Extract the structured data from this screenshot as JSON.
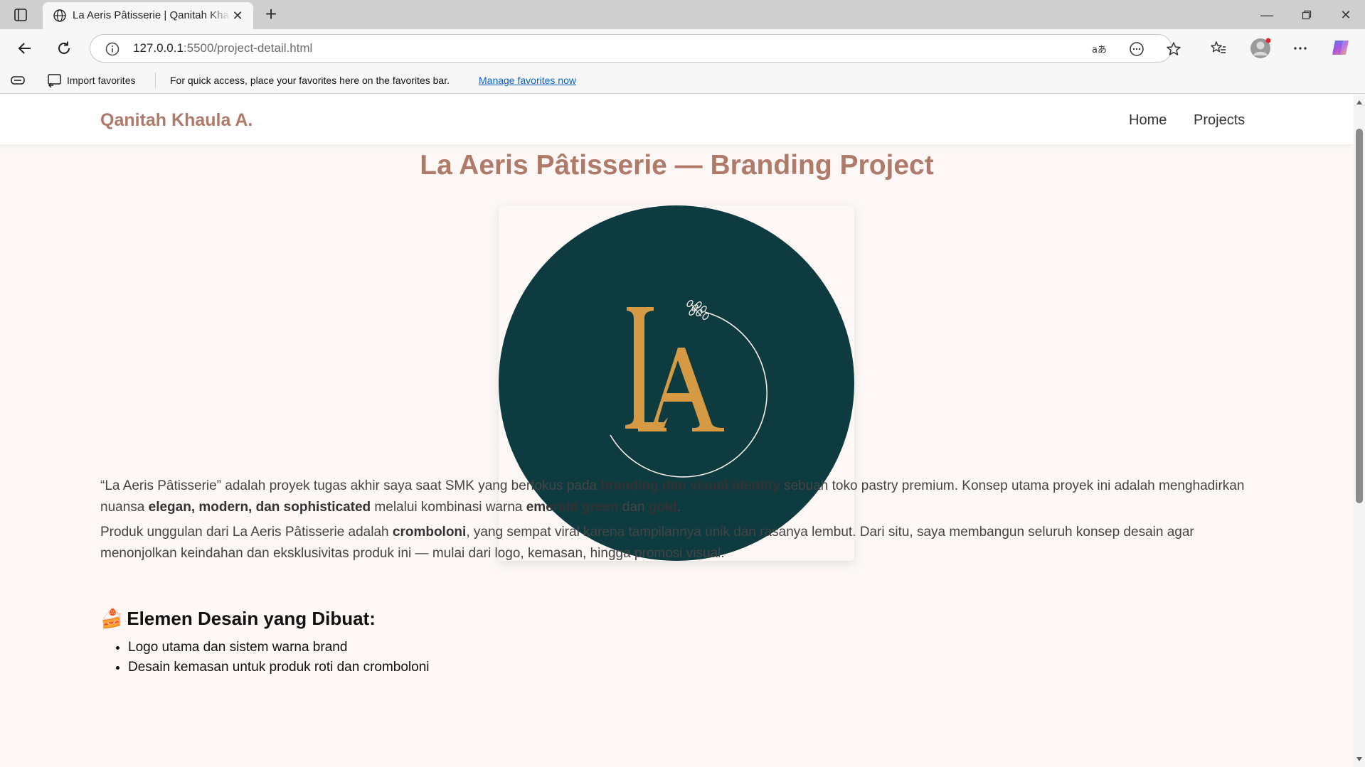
{
  "browser": {
    "tab_title": "La Aeris Pâtisserie | Qanitah Khaula A.",
    "url_host": "127.0.0.1",
    "url_path": ":5500/project-detail.html",
    "favorites": {
      "import_label": "Import favorites",
      "hint": "For quick access, place your favorites here on the favorites bar.",
      "manage_link": "Manage favorites now"
    },
    "icons": [
      "tab-actions-icon",
      "globe-icon",
      "close-icon",
      "new-tab-icon",
      "minimize-icon",
      "maximize-icon",
      "window-close-icon",
      "back-icon",
      "refresh-icon",
      "info-icon",
      "translate-icon",
      "reader-icon",
      "star-icon",
      "favorites-icon",
      "profile-icon",
      "more-icon",
      "copilot-icon",
      "favorites-bar-icon",
      "import-icon"
    ]
  },
  "site": {
    "brand": "Qanitah Khaula A.",
    "nav": [
      "Home",
      "Projects"
    ],
    "accent_color": "#b07a6a",
    "logo": {
      "letters": "LA",
      "bg_color": "#0e3b40",
      "letter_color": "#d69a45"
    }
  },
  "project": {
    "title": "La Aeris Pâtisserie — Branding Project",
    "paragraph1": {
      "t1": "“La Aeris Pâtisserie” adalah proyek tugas akhir saya saat SMK yang berfokus pada ",
      "b1": "branding dan visual identity",
      "t2": " sebuah toko pastry premium. Konsep utama proyek ini adalah menghadirkan nuansa ",
      "b2": "elegan, modern, dan sophisticated",
      "t3": " melalui kombinasi warna ",
      "b3": "emerald green",
      "t4": " dan ",
      "b4": "gold",
      "t5": "."
    },
    "paragraph2": {
      "t1": "Produk unggulan dari La Aeris Pâtisserie adalah ",
      "b1": "cromboloni",
      "t2": ", yang sempat viral karena tampilannya unik dan rasanya lembut. Dari situ, saya membangun seluruh konsep desain agar menonjolkan keindahan dan eksklusivitas produk ini — mulai dari logo, kemasan, hingga promosi visual."
    },
    "section_emoji": "🍰",
    "section_title": "Elemen Desain yang Dibuat:",
    "elements": [
      "Logo utama dan sistem warna brand",
      "Desain kemasan untuk produk roti dan cromboloni"
    ]
  }
}
